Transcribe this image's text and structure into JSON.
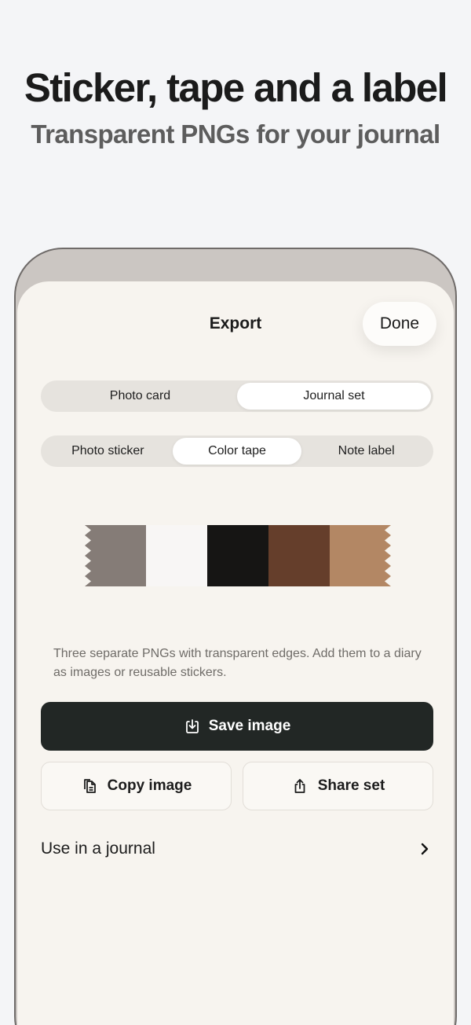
{
  "hero": {
    "title": "Sticker, tape and a label",
    "subtitle": "Transparent PNGs for your journal"
  },
  "sheet": {
    "title": "Export",
    "done_label": "Done"
  },
  "mode_tabs": [
    {
      "label": "Photo card",
      "selected": false
    },
    {
      "label": "Journal set",
      "selected": true
    }
  ],
  "item_tabs": [
    {
      "label": "Photo sticker",
      "selected": false
    },
    {
      "label": "Color tape",
      "selected": true
    },
    {
      "label": "Note label",
      "selected": false
    }
  ],
  "tape": {
    "swatches": [
      "#857c77",
      "#f8f6f5",
      "#161514",
      "#653e2b",
      "#b38764"
    ]
  },
  "caption": "Three separate PNGs with transparent edges. Add them to a diary as images or reusable stickers.",
  "actions": {
    "save_label": "Save image",
    "copy_label": "Copy image",
    "share_label": "Share set"
  },
  "journal_row": {
    "label": "Use in a journal"
  },
  "icons": {
    "save": "download-tray-icon",
    "copy": "copy-icon",
    "share": "share-icon",
    "chevron": "chevron-right-icon"
  }
}
